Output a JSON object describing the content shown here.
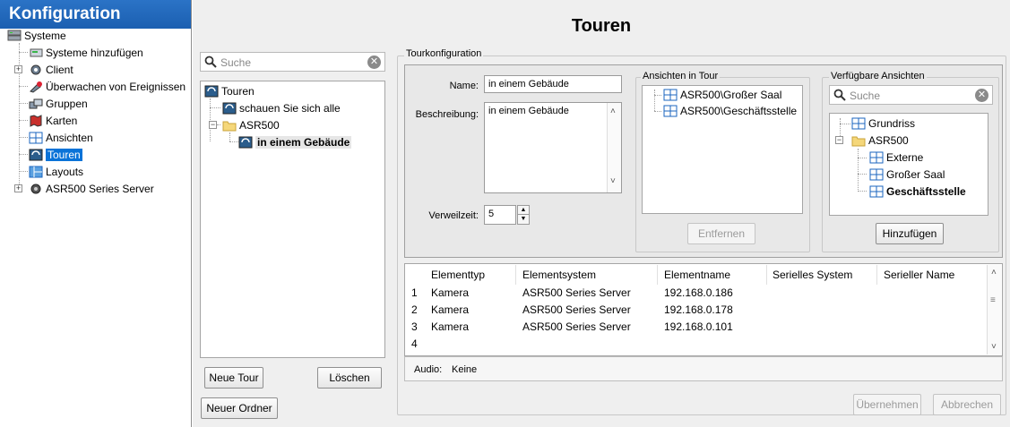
{
  "nav": {
    "title": "Konfiguration",
    "items": [
      {
        "label": "Systeme"
      },
      {
        "label": "Systeme hinzufügen"
      },
      {
        "label": "Client"
      },
      {
        "label": "Überwachen von Ereignissen"
      },
      {
        "label": "Gruppen"
      },
      {
        "label": "Karten"
      },
      {
        "label": "Ansichten"
      },
      {
        "label": "Touren"
      },
      {
        "label": "Layouts"
      },
      {
        "label": "ASR500 Series Server"
      }
    ]
  },
  "page": {
    "title": "Touren"
  },
  "tour_list": {
    "search_placeholder": "Suche",
    "tree": [
      {
        "label": "Touren"
      },
      {
        "label": "schauen Sie sich alle"
      },
      {
        "label": "ASR500"
      },
      {
        "label": "in einem Gebäude"
      }
    ],
    "new_tour_label": "Neue Tour",
    "delete_label": "Löschen",
    "new_folder_label": "Neuer Ordner"
  },
  "tour_config": {
    "legend": "Tourkonfiguration",
    "name_label": "Name:",
    "name_value": "in einem Gebäude",
    "desc_label": "Beschreibung:",
    "desc_value": "in einem Gebäude",
    "dwell_label": "Verweilzeit:",
    "dwell_value": "5"
  },
  "views_in_tour": {
    "legend": "Ansichten in Tour",
    "items": [
      {
        "label": "ASR500\\Großer Saal"
      },
      {
        "label": "ASR500\\Geschäftsstelle"
      }
    ],
    "remove_label": "Entfernen"
  },
  "available_views": {
    "legend": "Verfügbare Ansichten",
    "search_placeholder": "Suche",
    "tree": [
      {
        "label": "Grundriss"
      },
      {
        "label": "ASR500"
      },
      {
        "label": "Externe"
      },
      {
        "label": "Großer Saal"
      },
      {
        "label": "Geschäftsstelle"
      }
    ],
    "add_label": "Hinzufügen"
  },
  "elements_table": {
    "columns": [
      "Elementtyp",
      "Elementsystem",
      "Elementname",
      "Serielles System",
      "Serieller Name"
    ],
    "rows": [
      {
        "n": "1",
        "type": "Kamera",
        "system": "ASR500 Series Server",
        "name": "192.168.0.186"
      },
      {
        "n": "2",
        "type": "Kamera",
        "system": "ASR500 Series Server",
        "name": "192.168.0.178"
      },
      {
        "n": "3",
        "type": "Kamera",
        "system": "ASR500 Series Server",
        "name": "192.168.0.101"
      },
      {
        "n": "4",
        "type": "",
        "system": "",
        "name": ""
      }
    ],
    "audio_label": "Audio:",
    "audio_value": "Keine"
  },
  "footer": {
    "apply_label": "Übernehmen",
    "cancel_label": "Abbrechen"
  },
  "colors": {
    "accent": "#1b66bf",
    "selection": "#0a73d8",
    "panel": "#efefef"
  }
}
